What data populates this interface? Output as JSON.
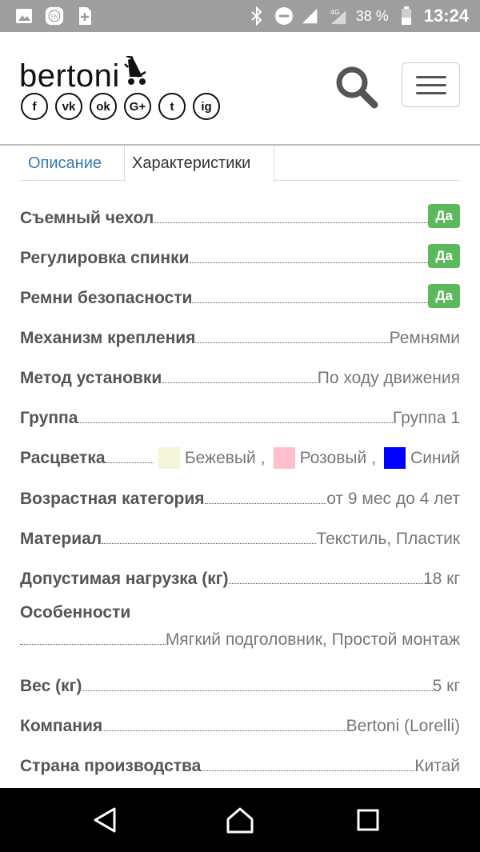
{
  "status_bar": {
    "battery_percent": "38 %",
    "time": "13:24",
    "network": "4G"
  },
  "header": {
    "logo_text": "bertoni",
    "socials": [
      {
        "name": "facebook-icon",
        "glyph": "f"
      },
      {
        "name": "vk-icon",
        "glyph": "vk"
      },
      {
        "name": "odnoklassniki-icon",
        "glyph": "ok"
      },
      {
        "name": "google-plus-icon",
        "glyph": "G+"
      },
      {
        "name": "twitter-icon",
        "glyph": "t"
      },
      {
        "name": "instagram-icon",
        "glyph": "ig"
      }
    ]
  },
  "tabs": [
    {
      "label": "Описание",
      "active": false
    },
    {
      "label": "Характеристики",
      "active": true
    }
  ],
  "properties": [
    {
      "name": "Съемный чехол",
      "badge": "Да"
    },
    {
      "name": "Регулировка спинки",
      "badge": "Да"
    },
    {
      "name": "Ремни безопасности",
      "badge": "Да"
    },
    {
      "name": "Механизм крепления",
      "value": "Ремнями"
    },
    {
      "name": "Метод установки",
      "value": "По ходу движения"
    },
    {
      "name": "Группа",
      "value": "Группа 1"
    },
    {
      "name": "Расцветка",
      "colors": [
        {
          "label": "Бежевый",
          "color": "#f5f5dc",
          "sep": ","
        },
        {
          "label": "Розовый",
          "color": "#ffc0cb",
          "sep": ","
        },
        {
          "label": "Синий",
          "color": "#0000ff",
          "sep": ""
        }
      ]
    },
    {
      "name": "Возрастная категория",
      "value": "от 9 мес до 4 лет"
    },
    {
      "name": "Материал",
      "value": "Текстиль, Пластик"
    },
    {
      "name": "Допустимая нагрузка (кг)",
      "value": "18 кг"
    },
    {
      "name": "Особенности",
      "value": "Мягкий подголовник, Простой монтаж"
    },
    {
      "name": "Вес (кг)",
      "value": "5 кг"
    },
    {
      "name": "Компания",
      "value": "Bertoni (Lorelli)"
    },
    {
      "name": "Страна производства",
      "value": "Китай"
    }
  ],
  "colors": {
    "badge_green": "#5cb85c",
    "link_blue": "#337ab7",
    "status_bar_bg": "#9e9e9e"
  }
}
